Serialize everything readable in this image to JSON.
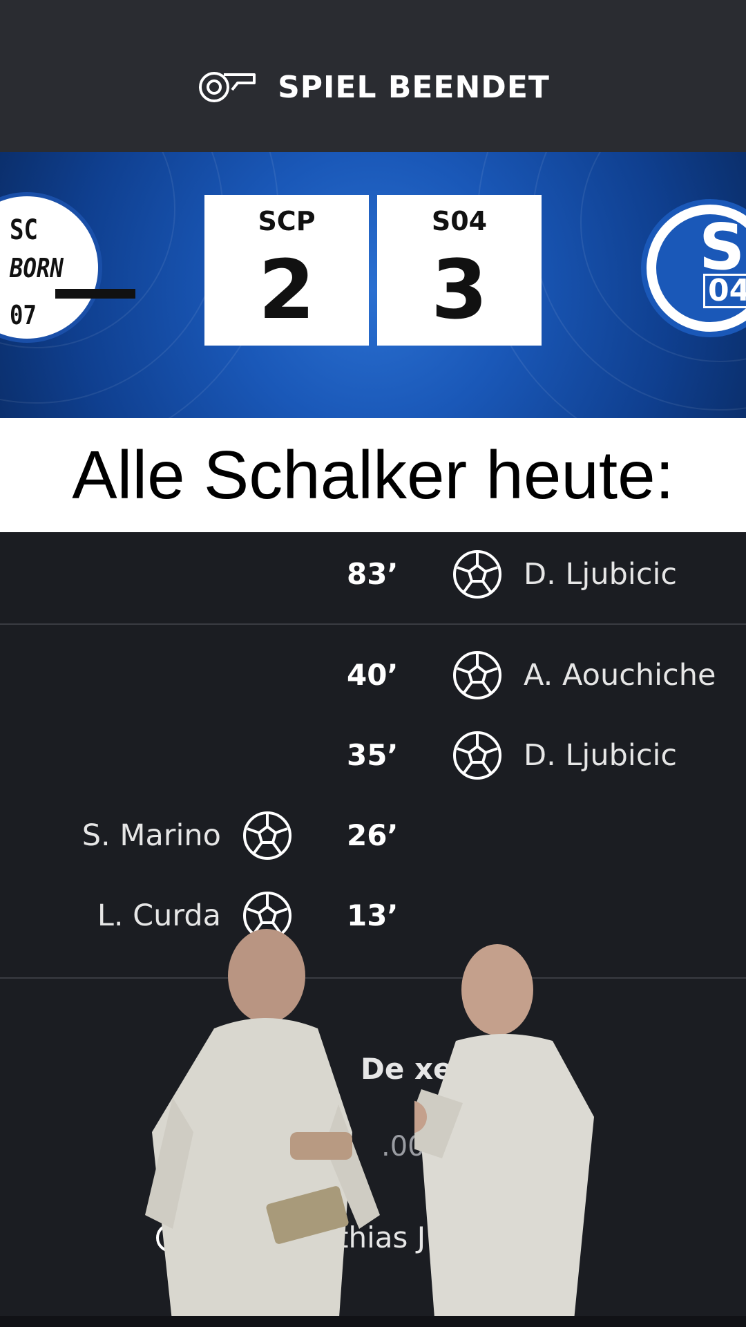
{
  "header": {
    "status": "SPIEL BEENDET",
    "icon": "whistle-icon"
  },
  "match": {
    "home": {
      "abbr": "SCP",
      "score": "2",
      "crest_lines": [
        "SC",
        "BORN",
        "07"
      ]
    },
    "away": {
      "abbr": "S04",
      "score": "3",
      "crest_letter": "S",
      "crest_number": "04"
    }
  },
  "caption": {
    "text": "Alle Schalker heute:"
  },
  "events": [
    {
      "minute": "83’",
      "side": "away",
      "player": "D. Ljubicic"
    },
    {
      "minute": "40’",
      "side": "away",
      "player": "A. Aouchiche"
    },
    {
      "minute": "35’",
      "side": "away",
      "player": "D. Ljubicic"
    },
    {
      "minute": "26’",
      "side": "home",
      "player": "S. Marino"
    },
    {
      "minute": "13’",
      "side": "home",
      "player": "L. Curda"
    }
  ],
  "info": {
    "stadium_fragment": "De  xe   a",
    "capacity_fragment": ".000 F",
    "referee_fragment": "thias J"
  },
  "colors": {
    "header_bg": "#2a2c31",
    "banner_blue": "#1a58b8",
    "page_bg": "#1b1d22"
  }
}
